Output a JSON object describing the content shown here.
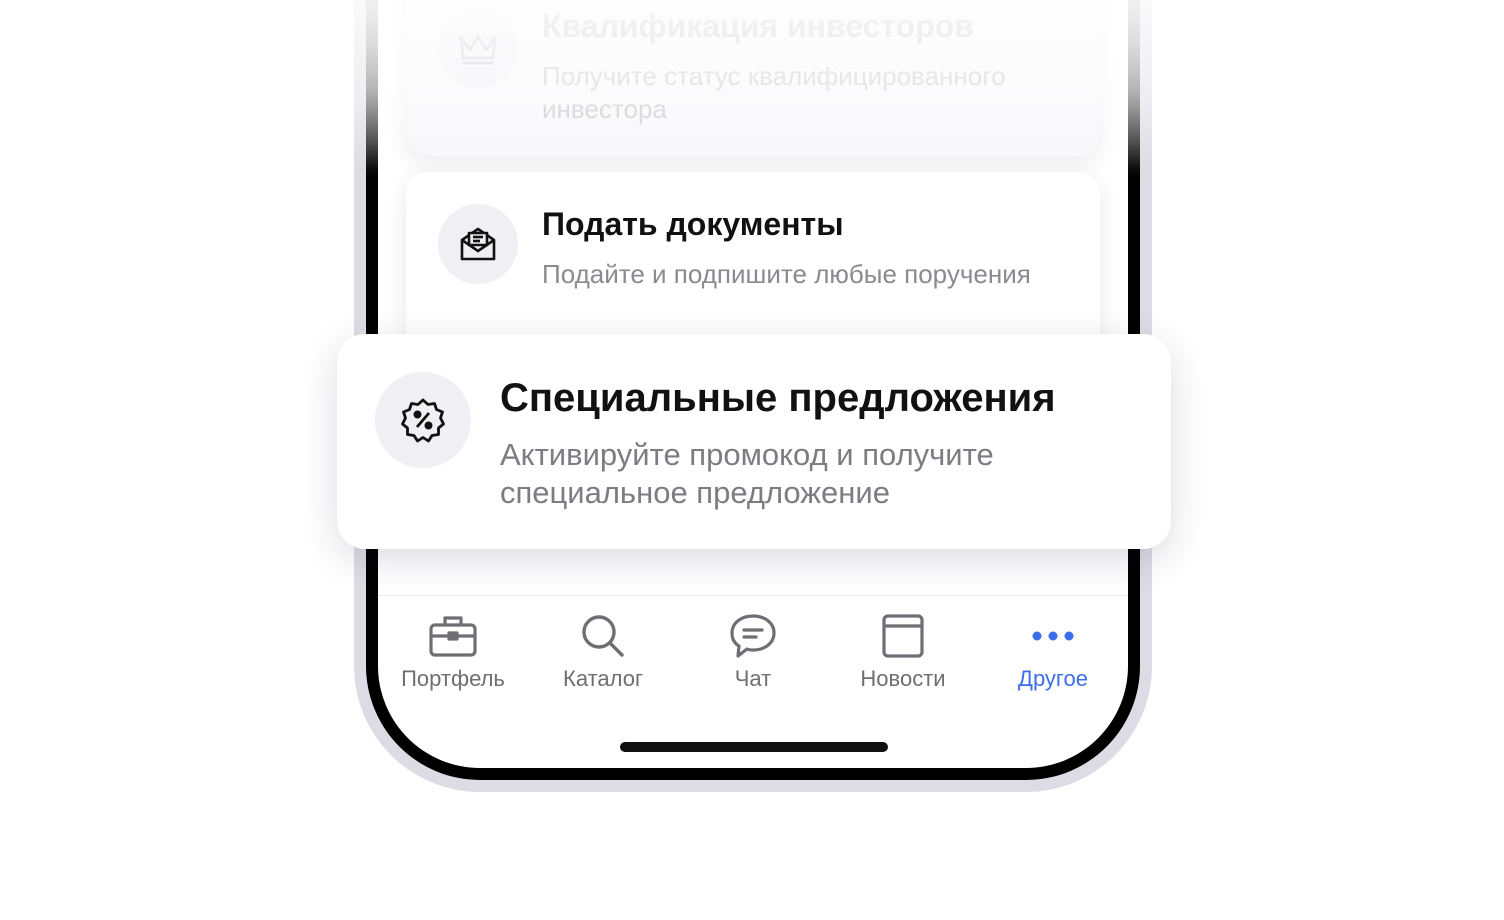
{
  "cards": [
    {
      "title": "Квалификация инвесторов",
      "subtitle": "Получите статус квалифицированного инвестора",
      "icon": "crown-icon"
    },
    {
      "title": "Подать документы",
      "subtitle": "Подайте и подпишите любые поручения",
      "icon": "envelope-icon"
    },
    {
      "title": "Специальные предложения",
      "subtitle": "Активируйте промокод и получите специальное предложение",
      "icon": "discount-badge-icon"
    }
  ],
  "tabbar": {
    "items": [
      {
        "label": "Портфель",
        "icon": "briefcase-icon",
        "active": false
      },
      {
        "label": "Каталог",
        "icon": "search-icon",
        "active": false
      },
      {
        "label": "Чат",
        "icon": "chat-icon",
        "active": false
      },
      {
        "label": "Новости",
        "icon": "news-icon",
        "active": false
      },
      {
        "label": "Другое",
        "icon": "more-icon",
        "active": true
      }
    ]
  },
  "colors": {
    "accent": "#3b6ee8",
    "text_primary": "#111111",
    "text_secondary": "#7c7c82",
    "icon_bg": "#efeff4"
  }
}
